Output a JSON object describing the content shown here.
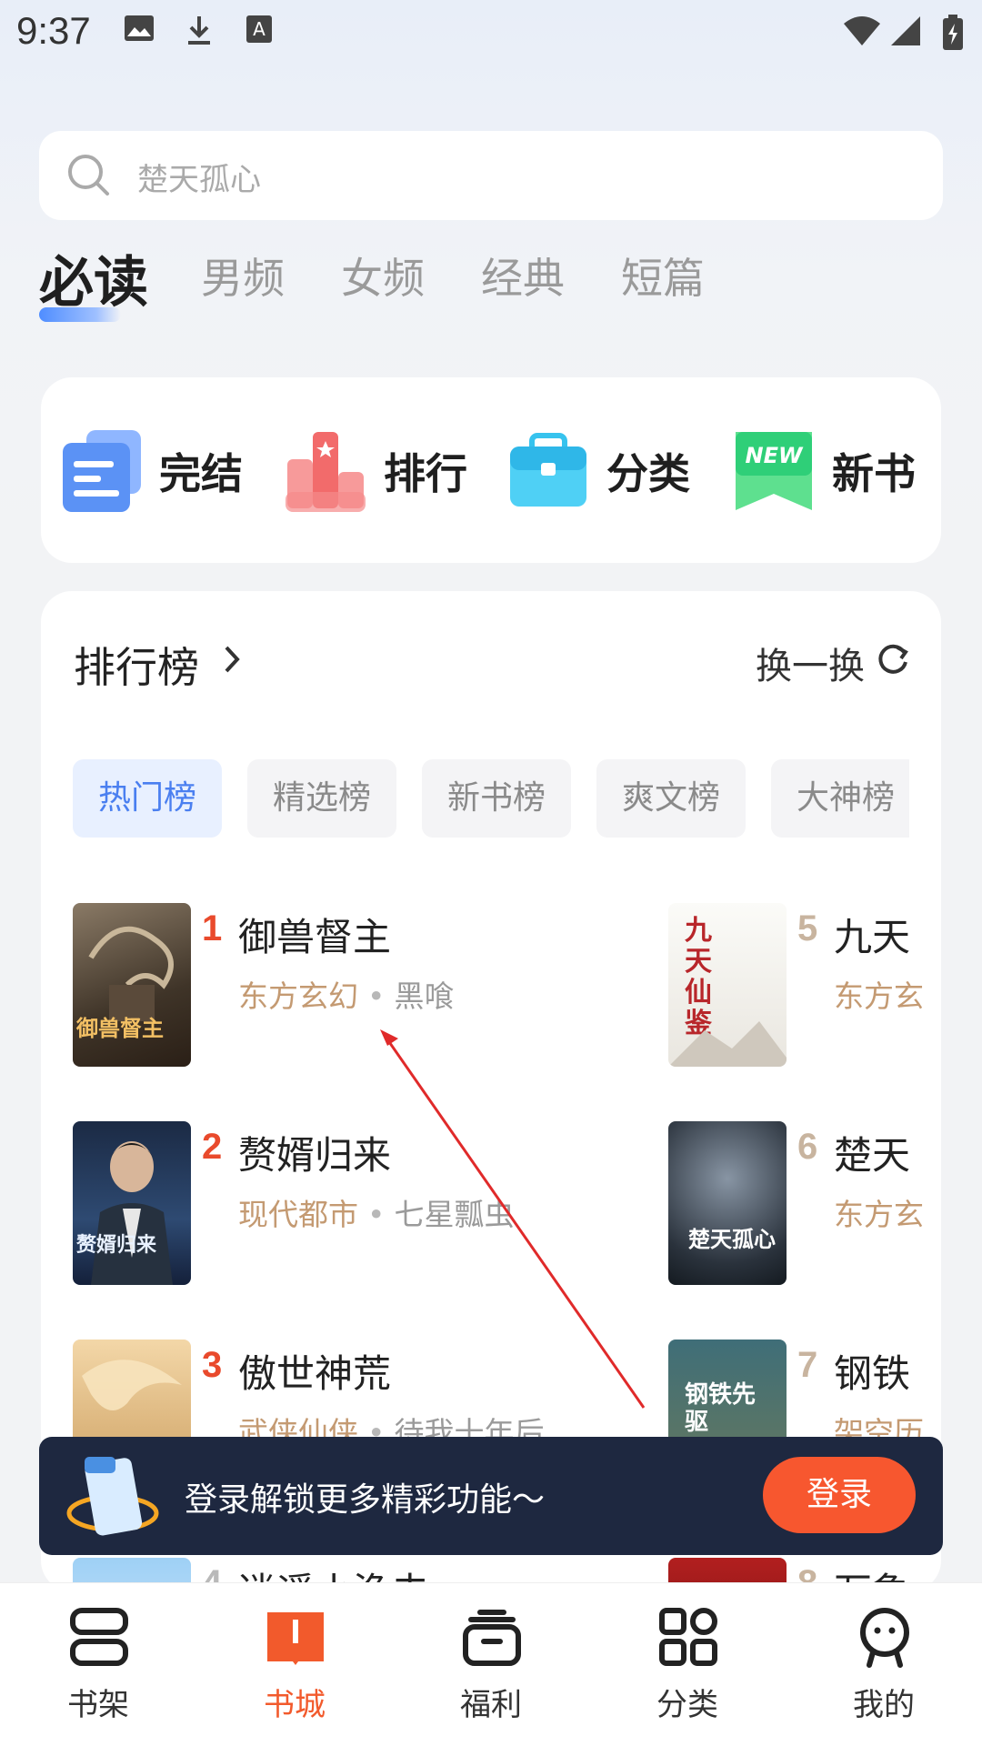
{
  "status_bar": {
    "time": "9:37"
  },
  "search": {
    "placeholder": "楚天孤心"
  },
  "top_tabs": [
    {
      "label": "必读",
      "active": true
    },
    {
      "label": "男频"
    },
    {
      "label": "女频"
    },
    {
      "label": "经典"
    },
    {
      "label": "短篇"
    }
  ],
  "quick_links": [
    {
      "label": "完结",
      "icon": "finished-icon"
    },
    {
      "label": "排行",
      "icon": "ranking-icon"
    },
    {
      "label": "分类",
      "icon": "category-icon"
    },
    {
      "label": "新书",
      "icon": "new-book-icon",
      "badge": "NEW"
    }
  ],
  "ranking": {
    "title": "排行榜",
    "refresh_label": "换一换",
    "chips": [
      "热门榜",
      "精选榜",
      "新书榜",
      "爽文榜",
      "大神榜"
    ],
    "books_left": [
      {
        "rank": "1",
        "title": "御兽督主",
        "genre": "东方玄幻",
        "author": "黑喰",
        "rank_color": "#e94a2c"
      },
      {
        "rank": "2",
        "title": "赘婿归来",
        "genre": "现代都市",
        "author": "七星瓢虫",
        "rank_color": "#e94a2c"
      },
      {
        "rank": "3",
        "title": "傲世神荒",
        "genre": "武侠仙侠",
        "author": "待我十年后",
        "rank_color": "#e94a2c"
      },
      {
        "rank": "4",
        "title": "逍遥小渔夫",
        "genre": "",
        "author": "",
        "rank_color": "#b9b9b9"
      }
    ],
    "books_right": [
      {
        "rank": "5",
        "title": "九天",
        "genre": "东方玄",
        "rank_color": "#c8b49f"
      },
      {
        "rank": "6",
        "title": "楚天",
        "genre": "东方玄",
        "rank_color": "#c8b49f"
      },
      {
        "rank": "7",
        "title": "钢铁",
        "genre": "架空历",
        "rank_color": "#c8b49f"
      },
      {
        "rank": "8",
        "title": "万象",
        "genre": "",
        "rank_color": "#c8b49f"
      }
    ],
    "cover_texts": {
      "b1": "御兽督主",
      "b2": "赘婿归来",
      "r5": "九天仙鉴",
      "r6": "楚天孤心",
      "r7": "钢铁先驱"
    }
  },
  "login_banner": {
    "text": "登录解锁更多精彩功能～",
    "button": "登录"
  },
  "bottom_nav": [
    {
      "label": "书架",
      "icon": "bookshelf-icon"
    },
    {
      "label": "书城",
      "icon": "bookstore-icon",
      "active": true
    },
    {
      "label": "福利",
      "icon": "gift-icon"
    },
    {
      "label": "分类",
      "icon": "grid-icon"
    },
    {
      "label": "我的",
      "icon": "profile-icon"
    }
  ],
  "colors": {
    "accent": "#f25a2c",
    "tab_blue": "#4a7ff0",
    "genre": "#c49a72",
    "banner_bg": "#1e2840"
  }
}
